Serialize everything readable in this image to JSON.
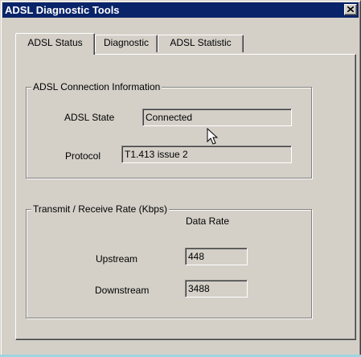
{
  "window": {
    "title": "ADSL Diagnostic Tools",
    "close_icon": "close-x-icon"
  },
  "tabs": [
    {
      "label": "ADSL Status",
      "active": true
    },
    {
      "label": "Diagnostic",
      "active": false
    },
    {
      "label": "ADSL Statistic",
      "active": false
    }
  ],
  "connection_group": {
    "title": "ADSL Connection Information",
    "state_label": "ADSL State",
    "state_value": "Connected",
    "protocol_label": "Protocol",
    "protocol_value": "T1.413 issue 2"
  },
  "rate_group": {
    "title": "Transmit / Receive Rate  (Kbps)",
    "column_header": "Data Rate",
    "upstream_label": "Upstream",
    "upstream_value": "448",
    "downstream_label": "Downstream",
    "downstream_value": "3488"
  },
  "colors": {
    "titlebar": "#0a246a",
    "face": "#d4d0c8"
  },
  "pointer": "arrow-cursor-icon"
}
